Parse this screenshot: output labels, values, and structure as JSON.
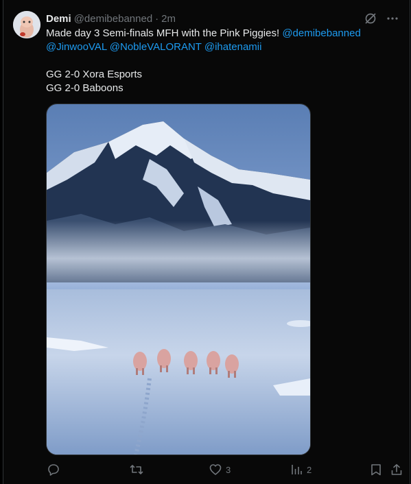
{
  "author": {
    "display_name": "Demi",
    "handle": "@demibebanned",
    "separator": "·",
    "time": "2m"
  },
  "tweet": {
    "line1_text": "Made day 3 Semi-finals MFH with the Pink Piggies! ",
    "line1_mention": "@demibebanned",
    "line2_mentions": [
      "@JinwooVAL",
      "@NobleVALORANT",
      "@ihatenamii"
    ],
    "line3": "",
    "line4": "GG 2-0 Xora Esports",
    "line5": "GG 2-0 Baboons"
  },
  "media": {
    "description_icon": "image",
    "scene_colors": {
      "sky": "#6e8fbf",
      "snow": "#c8d6ea",
      "mountain": "#1f2f4a",
      "pig": "#d9a3a0"
    }
  },
  "actions": {
    "reply": {
      "icon": "reply-icon",
      "count": ""
    },
    "retweet": {
      "icon": "retweet-icon",
      "count": ""
    },
    "like": {
      "icon": "heart-icon",
      "count": "3"
    },
    "views": {
      "icon": "views-icon",
      "count": "2"
    },
    "bookmark": {
      "icon": "bookmark-icon"
    },
    "share": {
      "icon": "share-icon"
    }
  },
  "colors": {
    "background": "#080808",
    "text": "#e7e9ea",
    "muted": "#71767b",
    "link": "#1d9bf0"
  }
}
